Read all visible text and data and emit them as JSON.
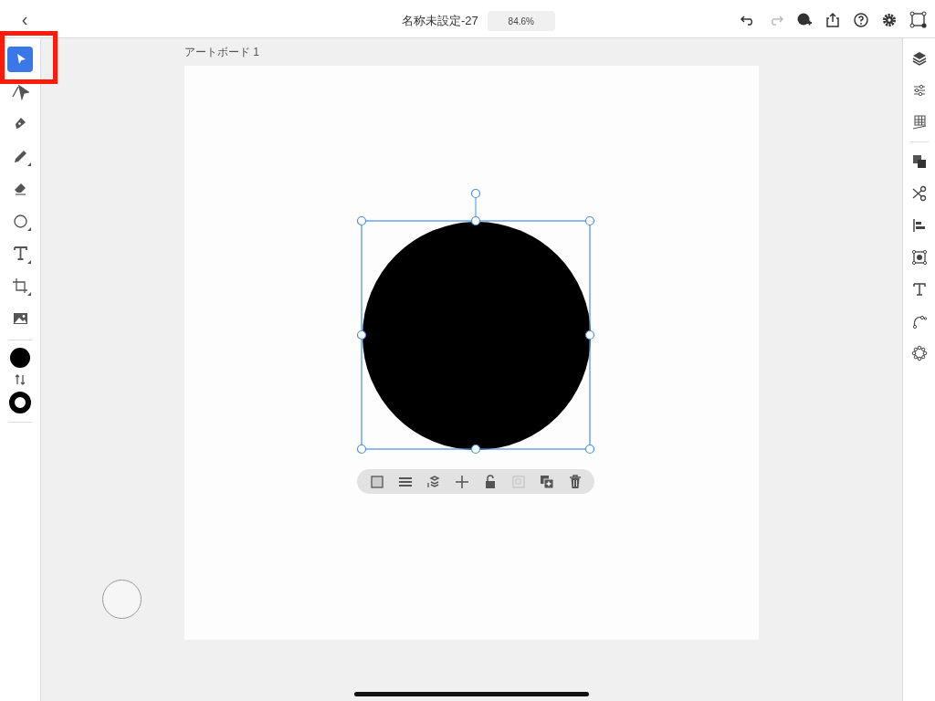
{
  "top_bar": {
    "back": "‹",
    "document_title": "名称未設定-27",
    "zoom": "84.6%"
  },
  "tools": [
    {
      "selected": true,
      "submenu": false
    },
    {
      "selected": false,
      "submenu": false
    },
    {
      "selected": false,
      "submenu": false
    },
    {
      "selected": false,
      "submenu": true
    },
    {
      "selected": false,
      "submenu": false
    },
    {
      "selected": false,
      "submenu": true
    },
    {
      "selected": false,
      "submenu": true
    },
    {
      "selected": false,
      "submenu": true
    },
    {
      "selected": false,
      "submenu": false
    }
  ],
  "fill": {
    "color": "#000000"
  },
  "stroke": {
    "color": "#000000"
  },
  "artboard": {
    "label": "アートボード 1"
  },
  "context_toolbar": [
    {
      "disabled": false
    },
    {
      "disabled": false
    },
    {
      "disabled": false
    },
    {
      "disabled": false
    },
    {
      "disabled": false
    },
    {
      "disabled": true
    },
    {
      "disabled": false
    },
    {
      "disabled": false
    }
  ]
}
